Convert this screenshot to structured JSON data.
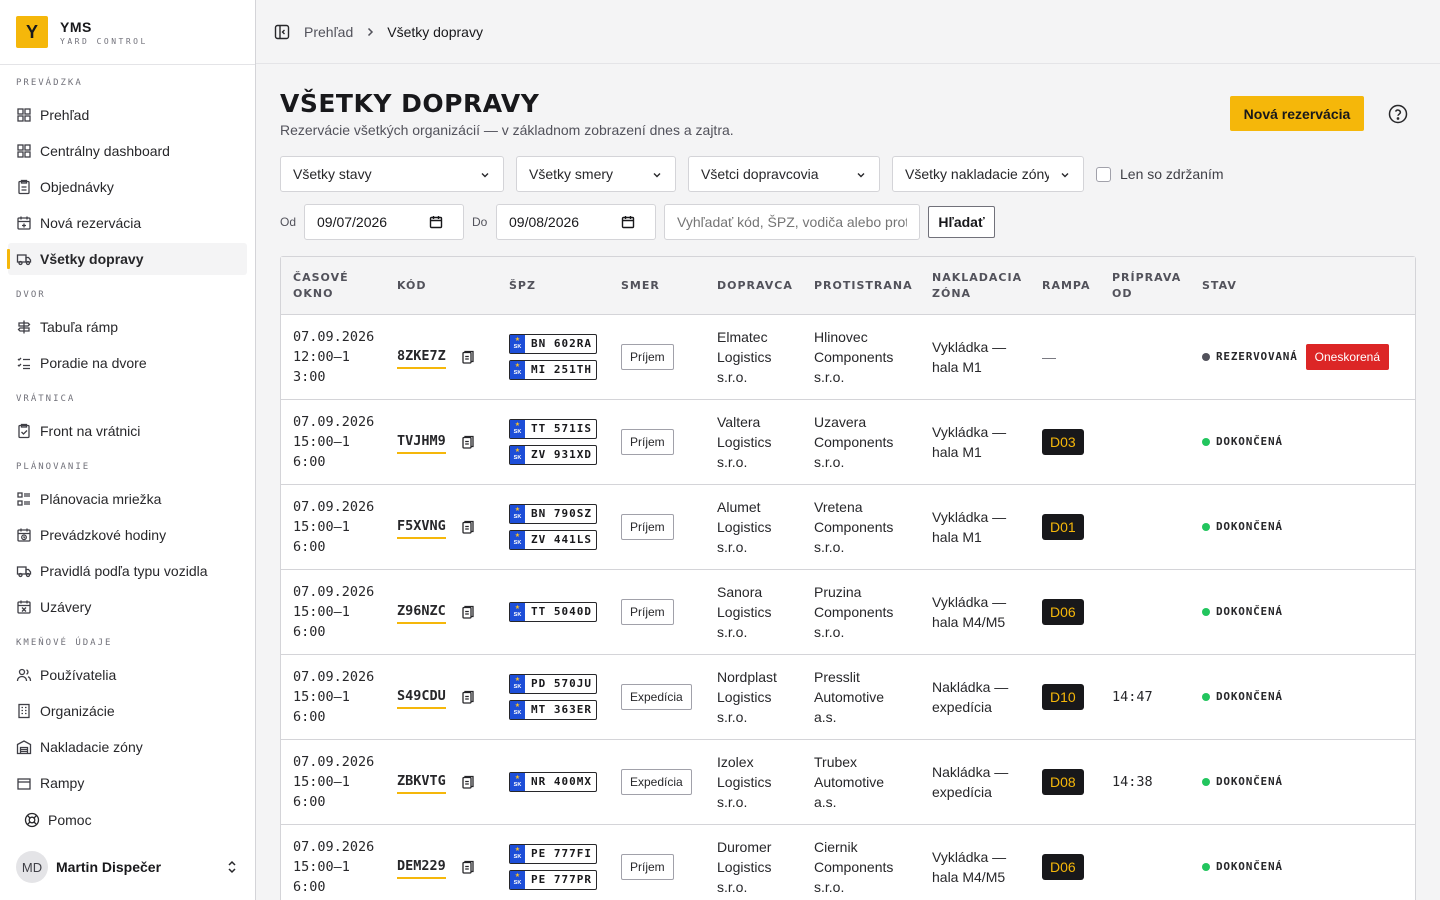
{
  "brand": {
    "logo": "Y",
    "name": "YMS",
    "sub": "YARD CONTROL"
  },
  "nav": [
    {
      "section": "PREVÁDZKA",
      "items": [
        {
          "label": "Prehľad",
          "icon": "grid-icon"
        },
        {
          "label": "Centrálny dashboard",
          "icon": "grid-icon"
        },
        {
          "label": "Objednávky",
          "icon": "clipboard-icon"
        },
        {
          "label": "Nová rezervácia",
          "icon": "calendar-plus-icon"
        },
        {
          "label": "Všetky dopravy",
          "icon": "truck-icon",
          "active": true
        }
      ]
    },
    {
      "section": "DVOR",
      "items": [
        {
          "label": "Tabuľa rámp",
          "icon": "signpost-icon"
        },
        {
          "label": "Poradie na dvore",
          "icon": "list-ordered-icon"
        }
      ]
    },
    {
      "section": "VRÁTNICA",
      "items": [
        {
          "label": "Front na vrátnici",
          "icon": "clipboard-check-icon"
        }
      ]
    },
    {
      "section": "PLÁNOVANIE",
      "items": [
        {
          "label": "Plánovacia mriežka",
          "icon": "grid-list-icon"
        },
        {
          "label": "Prevádzkové hodiny",
          "icon": "calendar-clock-icon"
        },
        {
          "label": "Pravidlá podľa typu vozidla",
          "icon": "truck-icon"
        },
        {
          "label": "Uzávery",
          "icon": "calendar-x-icon"
        }
      ]
    },
    {
      "section": "KMEŇOVÉ ÚDAJE",
      "items": [
        {
          "label": "Používatelia",
          "icon": "users-icon"
        },
        {
          "label": "Organizácie",
          "icon": "building-icon"
        },
        {
          "label": "Nakladacie zóny",
          "icon": "warehouse-icon"
        },
        {
          "label": "Rampy",
          "icon": "dock-icon"
        }
      ]
    }
  ],
  "help_label": "Pomoc",
  "user": {
    "initials": "MD",
    "name": "Martin Dispečer"
  },
  "breadcrumb": {
    "parent": "Prehľad",
    "current": "Všetky dopravy"
  },
  "page": {
    "title": "VŠETKY DOPRAVY",
    "subtitle": "Rezervácie všetkých organizácií — v základnom zobrazení dnes a zajtra.",
    "new_button": "Nová rezervácia"
  },
  "filters": {
    "status": "Všetky stavy",
    "direction": "Všetky smery",
    "carrier": "Všetci dopravcovia",
    "zone": "Všetky nakladacie zóny",
    "delay_label": "Len so zdržaním",
    "from_label": "Od",
    "from_value": "09/07/2026",
    "to_label": "Do",
    "to_value": "09/08/2026",
    "search_placeholder": "Vyhľadať kód, ŠPZ, vodiča alebo prot",
    "search_button": "Hľadať"
  },
  "columns": [
    "ČASOVÉ OKNO",
    "KÓD",
    "ŠPZ",
    "SMER",
    "DOPRAVCA",
    "PROTISTRANA",
    "NAKLADACIA ZÓNA",
    "RAMPA",
    "PRÍPRAVA OD",
    "STAV"
  ],
  "rows": [
    {
      "date": "07.09.2026",
      "time": "12:00–13:00",
      "code": "8ZKE7Z",
      "plates": [
        "BN 602RA",
        "MI 251TH"
      ],
      "direction": "Príjem",
      "carrier": [
        "Elmatec",
        "Logistics",
        "s.r.o."
      ],
      "counterparty": [
        "Hlinovec",
        "Components",
        "s.r.o."
      ],
      "zone": [
        "Vykládka —",
        "hala M1"
      ],
      "ramp": "—",
      "prep": "",
      "status": "REZERVOVANÁ",
      "status_color": "#52525b",
      "late": "Oneskorená"
    },
    {
      "date": "07.09.2026",
      "time": "15:00–16:00",
      "code": "TVJHM9",
      "plates": [
        "TT 571IS",
        "ZV 931XD"
      ],
      "direction": "Príjem",
      "carrier": [
        "Valtera",
        "Logistics",
        "s.r.o."
      ],
      "counterparty": [
        "Uzavera",
        "Components",
        "s.r.o."
      ],
      "zone": [
        "Vykládka —",
        "hala M1"
      ],
      "ramp": "D03",
      "prep": "",
      "status": "DOKONČENÁ",
      "status_color": "#22c55e",
      "late": ""
    },
    {
      "date": "07.09.2026",
      "time": "15:00–16:00",
      "code": "F5XVNG",
      "plates": [
        "BN 790SZ",
        "ZV 441LS"
      ],
      "direction": "Príjem",
      "carrier": [
        "Alumet",
        "Logistics",
        "s.r.o."
      ],
      "counterparty": [
        "Vretena",
        "Components",
        "s.r.o."
      ],
      "zone": [
        "Vykládka —",
        "hala M1"
      ],
      "ramp": "D01",
      "prep": "",
      "status": "DOKONČENÁ",
      "status_color": "#22c55e",
      "late": ""
    },
    {
      "date": "07.09.2026",
      "time": "15:00–16:00",
      "code": "Z96NZC",
      "plates": [
        "TT 5040D"
      ],
      "direction": "Príjem",
      "carrier": [
        "Sanora",
        "Logistics",
        "s.r.o."
      ],
      "counterparty": [
        "Pruzina",
        "Components",
        "s.r.o."
      ],
      "zone": [
        "Vykládka —",
        "hala M4/M5"
      ],
      "ramp": "D06",
      "prep": "",
      "status": "DOKONČENÁ",
      "status_color": "#22c55e",
      "late": ""
    },
    {
      "date": "07.09.2026",
      "time": "15:00–16:00",
      "code": "S49CDU",
      "plates": [
        "PD 570JU",
        "MT 363ER"
      ],
      "direction": "Expedícia",
      "carrier": [
        "Nordplast",
        "Logistics",
        "s.r.o."
      ],
      "counterparty": [
        "Presslit",
        "Automotive",
        "a.s."
      ],
      "zone": [
        "Nakládka —",
        "expedícia"
      ],
      "ramp": "D10",
      "prep": "14:47",
      "status": "DOKONČENÁ",
      "status_color": "#22c55e",
      "late": ""
    },
    {
      "date": "07.09.2026",
      "time": "15:00–16:00",
      "code": "ZBKVTG",
      "plates": [
        "NR 400MX"
      ],
      "direction": "Expedícia",
      "carrier": [
        "Izolex",
        "Logistics",
        "s.r.o."
      ],
      "counterparty": [
        "Trubex",
        "Automotive",
        "a.s."
      ],
      "zone": [
        "Nakládka —",
        "expedícia"
      ],
      "ramp": "D08",
      "prep": "14:38",
      "status": "DOKONČENÁ",
      "status_color": "#22c55e",
      "late": ""
    },
    {
      "date": "07.09.2026",
      "time": "15:00–16:00",
      "code": "DEM229",
      "plates": [
        "PE 777FI",
        "PE 777PR"
      ],
      "direction": "Príjem",
      "carrier": [
        "Duromer",
        "Logistics",
        "s.r.o."
      ],
      "counterparty": [
        "Ciernik",
        "Components",
        "s.r.o."
      ],
      "zone": [
        "Vykládka —",
        "hala M4/M5"
      ],
      "ramp": "D06",
      "prep": "",
      "status": "DOKONČENÁ",
      "status_color": "#22c55e",
      "late": ""
    }
  ],
  "plate_country": "SK"
}
